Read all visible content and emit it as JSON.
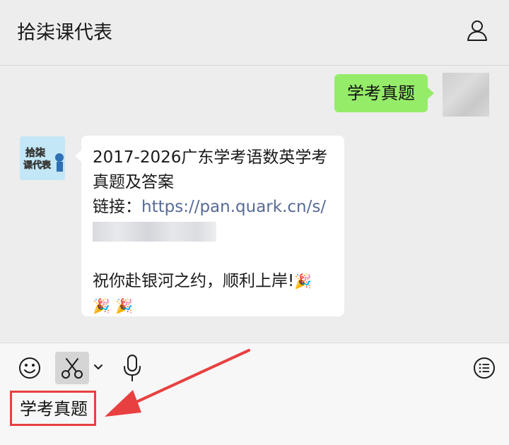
{
  "header": {
    "title": "拾柒课代表",
    "profile_icon": "person-icon"
  },
  "messages": {
    "sent": {
      "text": "学考真题"
    },
    "reply": {
      "avatar_text_top": "拾柒",
      "avatar_text_bottom": "课代表",
      "line1": "2017-2026广东学考语数英学考",
      "line2": "真题及答案",
      "link_label": "链接：",
      "link_url": "https://pan.quark.cn/s/",
      "closing": "祝你赴银河之约，顺利上岸!",
      "emoji": "🎉"
    }
  },
  "toolbar": {
    "emoji_icon": "smiley-icon",
    "scissors_icon": "scissors-icon",
    "chevron_icon": "chevron-down-icon",
    "mic_icon": "microphone-icon",
    "list_icon": "list-icon"
  },
  "input": {
    "text": "学考真题"
  },
  "colors": {
    "sent_bubble": "#95ec69",
    "link": "#576b95",
    "annotation": "#e84040"
  }
}
